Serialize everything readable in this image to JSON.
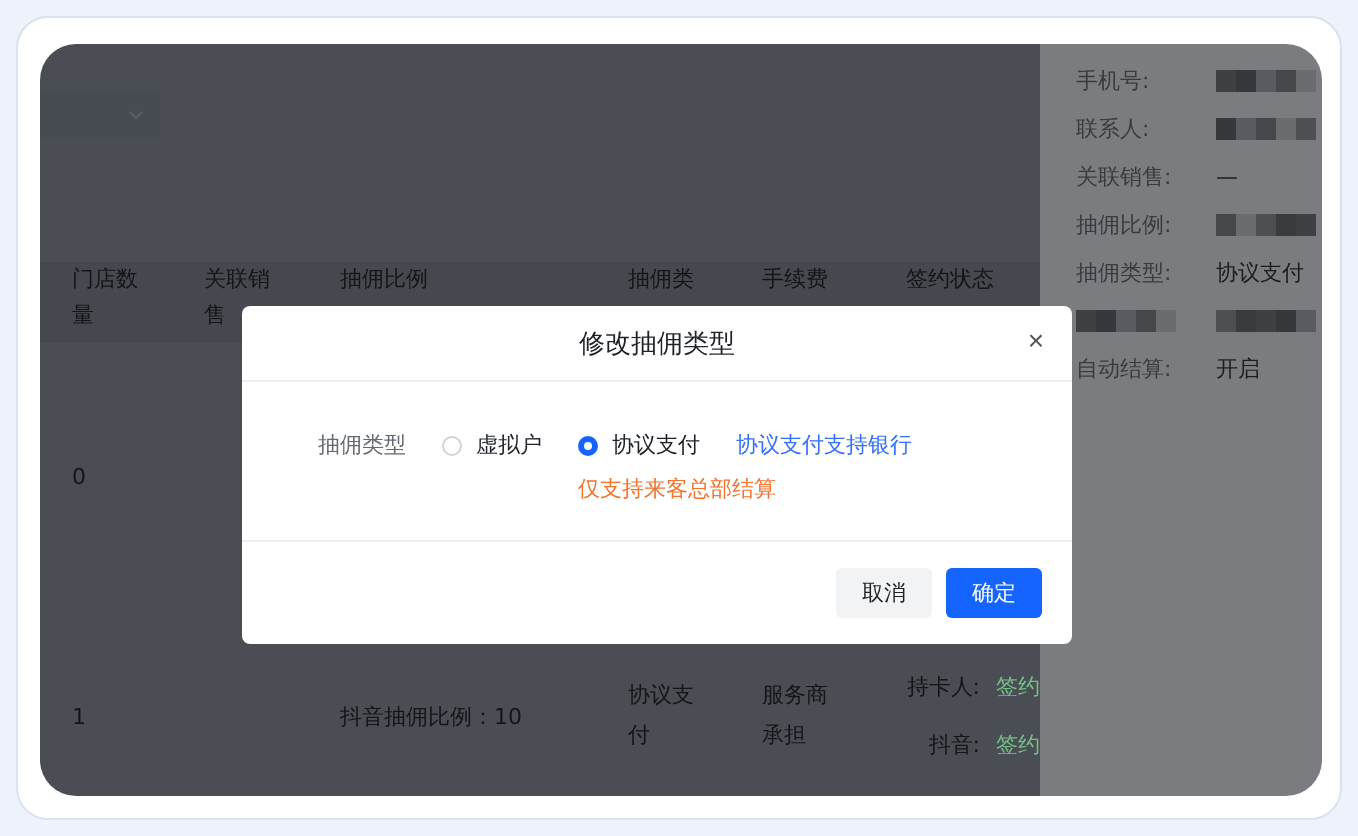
{
  "table": {
    "columns": [
      "门店数量",
      "关联销售",
      "抽佣比例",
      "抽佣类",
      "手续费",
      "签约状态"
    ],
    "rows": [
      {
        "store_count": "0",
        "ratio": "",
        "type": "",
        "fee": "",
        "status": []
      },
      {
        "store_count": "1",
        "ratio": "抖音抽佣比例：10",
        "type": "协议支付",
        "fee": "服务商承担",
        "status": [
          {
            "label": "持卡人:",
            "value": "签约"
          },
          {
            "label": "抖音:",
            "value": "签约"
          }
        ]
      }
    ]
  },
  "drawer": {
    "fields": [
      {
        "label": "手机号:",
        "kind": "blurred"
      },
      {
        "label": "联系人:",
        "kind": "blurred"
      },
      {
        "label": "关联销售:",
        "kind": "text",
        "value": "—"
      },
      {
        "label": "抽佣比例:",
        "kind": "blurred"
      },
      {
        "label": "抽佣类型:",
        "kind": "text",
        "value": "协议支付"
      },
      {
        "kind": "blurred"
      },
      {
        "label": "自动结算:",
        "kind": "text",
        "value": "开启"
      }
    ]
  },
  "dialog": {
    "title": "修改抽佣类型",
    "close": "×",
    "field_label": "抽佣类型",
    "options": [
      {
        "label": "虚拟户",
        "selected": false
      },
      {
        "label": "协议支付",
        "selected": true
      }
    ],
    "link": "协议支付支持银行",
    "note": "仅支持来客总部结算",
    "buttons": [
      {
        "label": "取消",
        "kind": "secondary"
      },
      {
        "label": "确定",
        "kind": "primary"
      }
    ]
  }
}
